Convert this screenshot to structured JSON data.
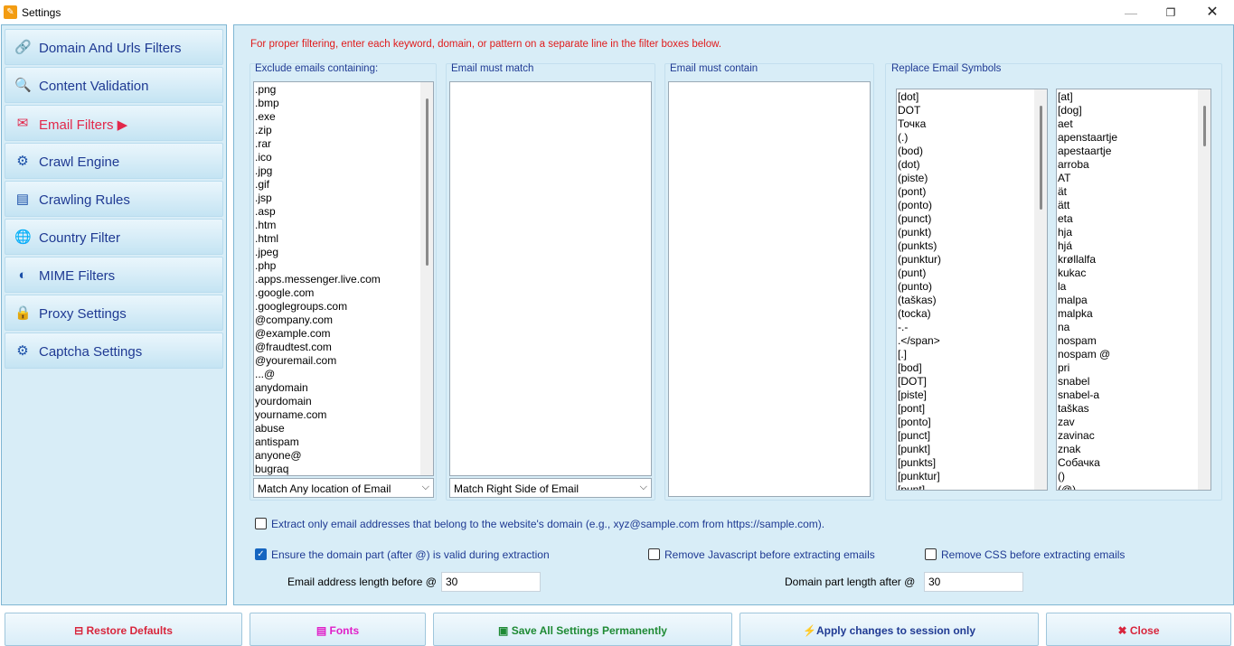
{
  "window": {
    "title": "Settings"
  },
  "sidebar": {
    "items": [
      {
        "label": "Domain And Urls Filters",
        "icon": "link-icon"
      },
      {
        "label": "Content Validation",
        "icon": "magnifier-icon"
      },
      {
        "label": "Email Filters ▶",
        "icon": "email-icon",
        "active": true
      },
      {
        "label": "Crawl Engine",
        "icon": "gear-icon"
      },
      {
        "label": "Crawling Rules",
        "icon": "rules-icon"
      },
      {
        "label": "Country Filter",
        "icon": "globe-icon"
      },
      {
        "label": "MIME Filters",
        "icon": "shield-icon"
      },
      {
        "label": "Proxy Settings",
        "icon": "lock-icon"
      },
      {
        "label": "Captcha Settings",
        "icon": "gears-icon"
      }
    ]
  },
  "main": {
    "notice": "For proper filtering, enter each keyword, domain, or pattern on a separate line in the filter boxes below.",
    "exclude": {
      "title": "Exclude emails containing:",
      "items": [
        ".png",
        ".bmp",
        ".exe",
        ".zip",
        ".rar",
        ".ico",
        ".jpg",
        ".gif",
        ".jsp",
        ".asp",
        ".htm",
        ".html",
        ".jpeg",
        ".php",
        ".apps.messenger.live.com",
        ".google.com",
        ".googlegroups.com",
        "@company.com",
        "@example.com",
        "@fraudtest.com",
        "@youremail.com",
        "...@",
        "anydomain",
        "yourdomain",
        "yourname.com",
        "abuse",
        "antispam",
        "anyone@",
        "bugraq"
      ],
      "select_value": "Match Any location of Email"
    },
    "must_match": {
      "title": "Email must match",
      "select_value": "Match Right Side of Email"
    },
    "must_contain": {
      "title": "Email must contain"
    },
    "replace": {
      "title": "Replace Email Symbols",
      "left_items": [
        " [dot]",
        " DOT",
        " Точка",
        "(.)",
        "(bod)",
        "(dot)",
        "(piste)",
        "(pont)",
        "(ponto)",
        "(punct)",
        "(punkt)",
        "(punkts)",
        "(punktur)",
        "(punt)",
        "(punto)",
        "(taškas)",
        "(tocka)",
        "-.-",
        ".</span>",
        "[.]",
        "[bod]",
        "[DOT]",
        "[piste]",
        "[pont]",
        "[ponto]",
        "[punct]",
        "[punkt]",
        "[punkts]",
        "[punktur]",
        "[punt]"
      ],
      "right_items": [
        "[at]",
        "[dog]",
        "aet",
        "apenstaartje",
        "apestaartje",
        "arroba",
        "AT",
        "ät",
        "ätt",
        "eta",
        "hja",
        "hjá",
        "krøllalfa",
        "kukac",
        "la",
        "malpa",
        "malpka",
        "na",
        "nospam",
        "nospam @",
        "pri",
        "snabel",
        "snabel-a",
        "taškas",
        "zav",
        "zavinac",
        "znak",
        "Собачка",
        "()",
        "(@)"
      ]
    },
    "options": {
      "extract_own_domain": {
        "label": "Extract only email addresses that belong to the website's domain (e.g., xyz@sample.com from https://sample.com).",
        "checked": false
      },
      "validate_domain": {
        "label": "Ensure the domain part (after @) is valid during extraction",
        "checked": true
      },
      "remove_js": {
        "label": "Remove Javascript before extracting emails",
        "checked": false
      },
      "remove_css": {
        "label": "Remove CSS before extracting emails",
        "checked": false
      }
    },
    "lengths": {
      "before_label": "Email address length before @",
      "before_value": "30",
      "after_label": "Domain part length after @",
      "after_value": "30"
    }
  },
  "buttons": {
    "restore": "Restore Defaults",
    "fonts": "Fonts",
    "save": "Save All Settings Permanently",
    "apply": "Apply changes to session only",
    "close": "Close"
  }
}
